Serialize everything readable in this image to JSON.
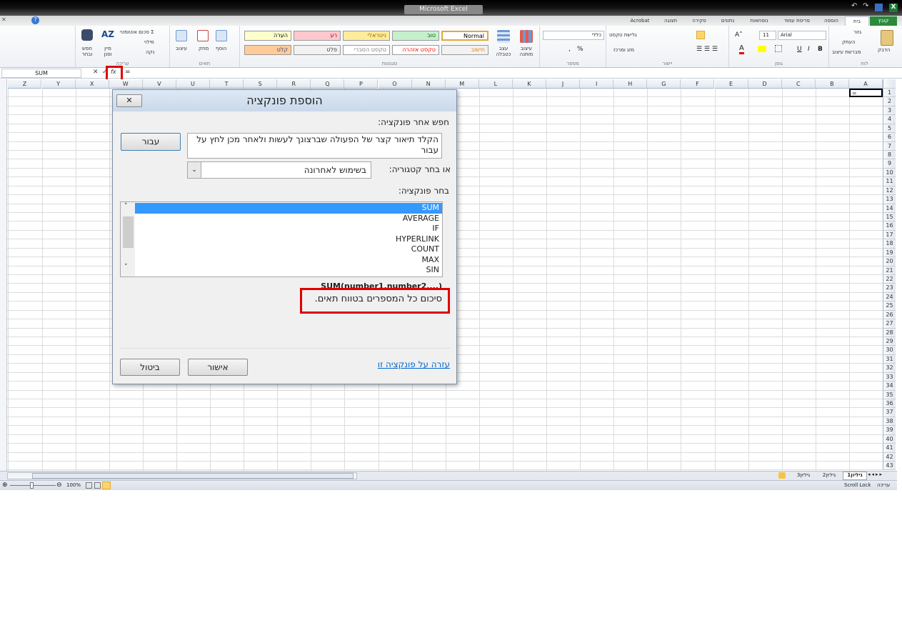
{
  "window": {
    "title": "Microsoft Excel"
  },
  "tabs": [
    "קובץ",
    "בית",
    "הוספה",
    "פריסת עמוד",
    "נוסחאות",
    "נתונים",
    "סקירה",
    "תצוגה",
    "Acrobat"
  ],
  "ribbon": {
    "clipboard": {
      "label": "לוח",
      "paste": "הדבק",
      "cut": "גזור",
      "copy": "העתק",
      "format_painter": "מברשת עיצוב"
    },
    "font": {
      "label": "גופן",
      "name": "Arial",
      "size": "11",
      "bold": "B",
      "italic": "I",
      "underline": "U"
    },
    "alignment": {
      "label": "יישור",
      "wrap": "גלישת טקסט",
      "merge": "מזג ומרכז"
    },
    "number": {
      "label": "מספר",
      "format": "כללי",
      "percent": "%",
      "comma": ","
    },
    "styles": {
      "label": "סגנונות",
      "conditional": "עיצוב מותנה",
      "as_table": "עצב כטבלה",
      "items": [
        {
          "label": "Normal",
          "bg": "#ffffff",
          "color": "#000"
        },
        {
          "label": "טוב",
          "bg": "#c6efce",
          "color": "#006100"
        },
        {
          "label": "ניטראלי",
          "bg": "#ffeb9c",
          "color": "#9c6500"
        },
        {
          "label": "רע",
          "bg": "#ffc7ce",
          "color": "#9c0006"
        },
        {
          "label": "הערה",
          "bg": "#ffffcc",
          "color": "#000"
        },
        {
          "label": "חישוב",
          "bg": "#f2f2f2",
          "color": "#fa7d00"
        },
        {
          "label": "טקסט אזהרה",
          "bg": "#ffffff",
          "color": "#ff0000"
        },
        {
          "label": "טקסט הסברי",
          "bg": "#ffffff",
          "color": "#7f7f7f"
        },
        {
          "label": "פלט",
          "bg": "#f2f2f2",
          "color": "#3f3f3f"
        },
        {
          "label": "קלט",
          "bg": "#ffcc99",
          "color": "#3f3f76"
        }
      ]
    },
    "cells": {
      "label": "תאים",
      "insert": "הוסף",
      "delete": "מחק",
      "format": "עיצוב"
    },
    "editing": {
      "label": "עריכה",
      "autosum": "סכום אוטומטי",
      "fill": "מילוי",
      "clear": "נקה",
      "sort": "מיין וסנן",
      "find": "חפש ובחר"
    }
  },
  "formula_bar": {
    "name_box": "SUM",
    "fx": "fx",
    "formula": "="
  },
  "columns": [
    "A",
    "B",
    "C",
    "D",
    "E",
    "F",
    "G",
    "H",
    "I",
    "J",
    "K",
    "L",
    "M",
    "N",
    "O",
    "P",
    "Q",
    "R",
    "S",
    "T",
    "U",
    "V",
    "W",
    "X",
    "Y",
    "Z"
  ],
  "rows": 43,
  "cells": {
    "A1": "="
  },
  "dialog": {
    "title": "הוספת פונקציה",
    "search_label": "חפש אחר פונקציה:",
    "search_value": "הקלד תיאור קצר של הפעולה שברצונך לעשות ולאחר מכן לחץ על עבור",
    "go": "עבור",
    "category_label": "או בחר קטגוריה:",
    "category_value": "בשימוש לאחרונה",
    "select_label": "בחר פונקציה:",
    "functions": [
      "SUM",
      "AVERAGE",
      "IF",
      "HYPERLINK",
      "COUNT",
      "MAX",
      "SIN"
    ],
    "selected": "SUM",
    "syntax": "SUM(number1,number2,...)",
    "description": "סיכום כל המספרים בטווח תאים.",
    "help_link": "עזרה על פונקציה זו",
    "ok": "אישור",
    "cancel": "ביטול"
  },
  "sheets": [
    "גיליון1",
    "גיליון2",
    "גיליון3"
  ],
  "status": {
    "mode": "עריכה",
    "scroll_lock": "Scroll Lock",
    "zoom": "100%"
  },
  "accent": "#217346"
}
